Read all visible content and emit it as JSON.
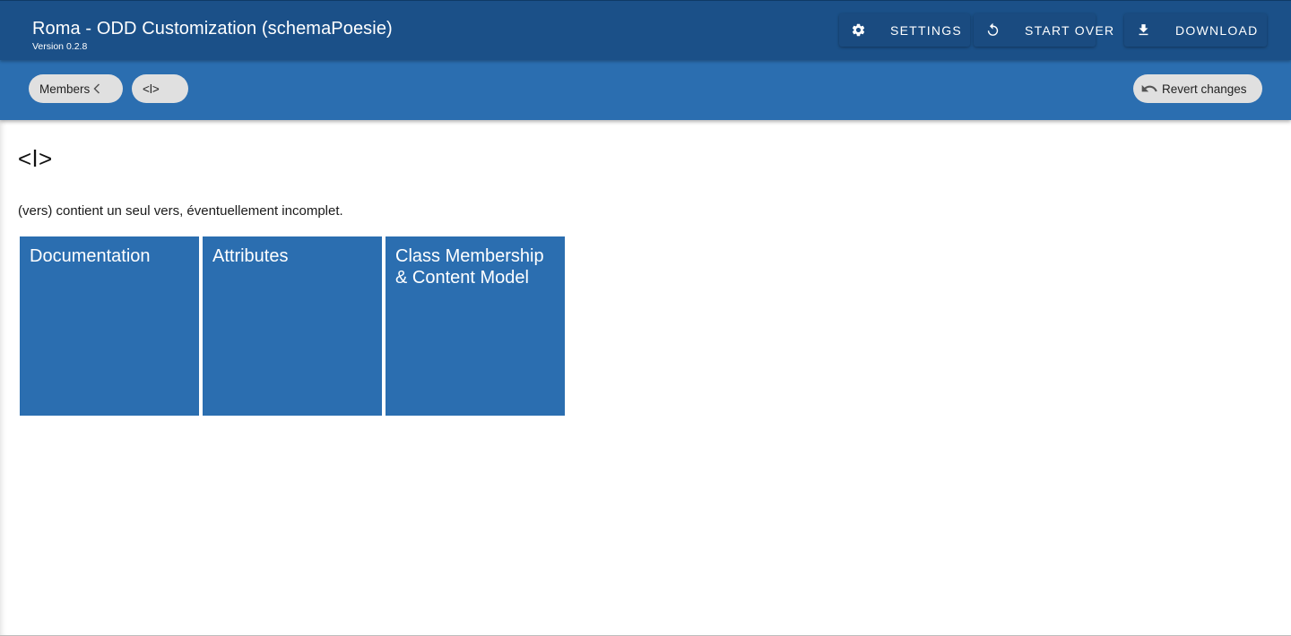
{
  "app": {
    "title": "Roma - ODD Customization (schemaPoesie)",
    "version": "Version 0.2.8"
  },
  "toolbar": {
    "settings_label": "SETTINGS",
    "start_over_label": "START OVER",
    "download_label": "DOWNLOAD"
  },
  "breadcrumbs": {
    "members_label": "Members",
    "element_label": "<l>"
  },
  "revert_label": "Revert changes",
  "element": {
    "title": "<l>",
    "description": "(vers) contient un seul vers, éventuellement incomplet."
  },
  "cards": {
    "documentation": "Documentation",
    "attributes": "Attributes",
    "class_membership": "Class Membership & Content Model"
  },
  "colors": {
    "app_bar": "#1b5088",
    "sub_bar": "#2b6eb0",
    "card": "#2b6eb0",
    "chip": "#e0e0e0"
  }
}
